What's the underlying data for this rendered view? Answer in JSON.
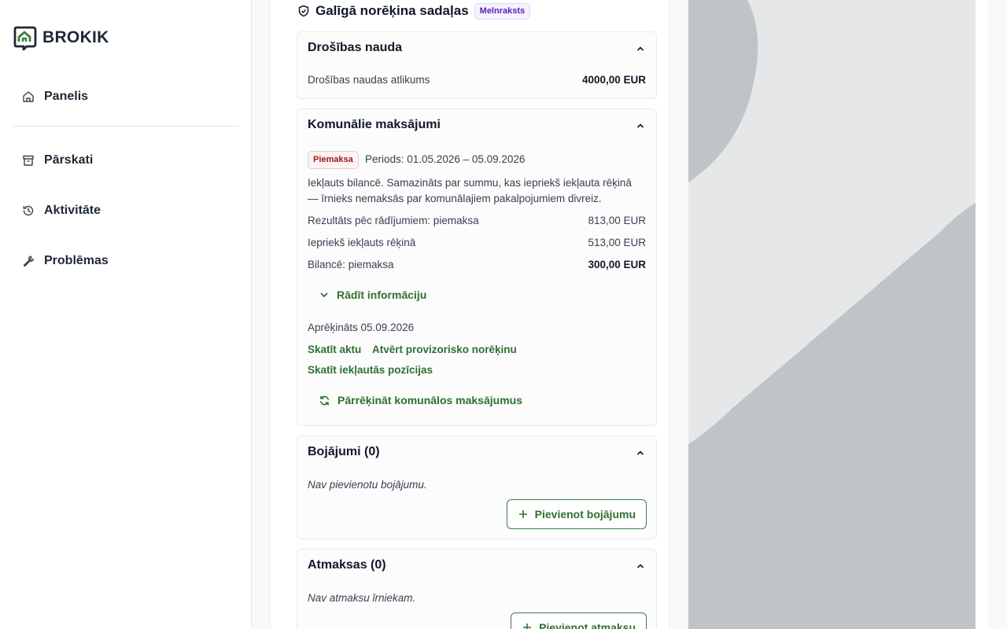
{
  "app": {
    "name": "BROKIK"
  },
  "sidebar": {
    "items": [
      {
        "label": "Panelis",
        "icon": "home-icon"
      },
      {
        "label": "Pārskati",
        "icon": "archive-icon"
      },
      {
        "label": "Aktivitāte",
        "icon": "history-icon"
      },
      {
        "label": "Problēmas",
        "icon": "wrench-icon"
      }
    ]
  },
  "panel": {
    "title": "Galīgā norēķina sadaļas",
    "status": "Melnraksts",
    "sections": {
      "deposit": {
        "title": "Drošības nauda",
        "rows": [
          {
            "label": "Drošības naudas atlikums",
            "value": "4000,00 EUR"
          }
        ]
      },
      "utilities": {
        "title": "Komunālie maksājumi",
        "badge": "Piemaksa",
        "period": "Periods: 01.05.2026 – 05.09.2026",
        "note_line1": "Iekļauts bilancē. Samazināts par summu, kas iepriekš iekļauta rēķinā",
        "note_line2": "— īrnieks nemaksās par komunālajiem pakalpojumiem divreiz.",
        "rows": [
          {
            "label": "Rezultāts pēc rādījumiem: piemaksa",
            "value": "813,00 EUR"
          },
          {
            "label": "Iepriekš iekļauts rēķinā",
            "value": "513,00 EUR"
          },
          {
            "label": "Bilancē: piemaksa",
            "value": "300,00 EUR"
          }
        ],
        "show_info": "Rādīt informāciju",
        "calculated": "Aprēķināts 05.09.2026",
        "link_act": "Skatīt aktu",
        "link_invoice": "Atvērt provizorisko norēķinu",
        "link_items": "Skatīt iekļautās pozīcijas",
        "recalc": "Pārrēķināt komunālos maksājumus"
      },
      "damages": {
        "title": "Bojājumi (0)",
        "empty": "Nav pievienotu bojājumu.",
        "add": "Pievienot bojājumu"
      },
      "refunds": {
        "title": "Atmaksas (0)",
        "empty": "Nav atmaksu īrniekam.",
        "add": "Pievienot atmaksu"
      }
    }
  },
  "colors": {
    "accent_green": "#2f6f31",
    "draft_purple": "#5b21b6",
    "overpay_red": "#991b1b",
    "illustration_gray": "#c0c5c8"
  }
}
